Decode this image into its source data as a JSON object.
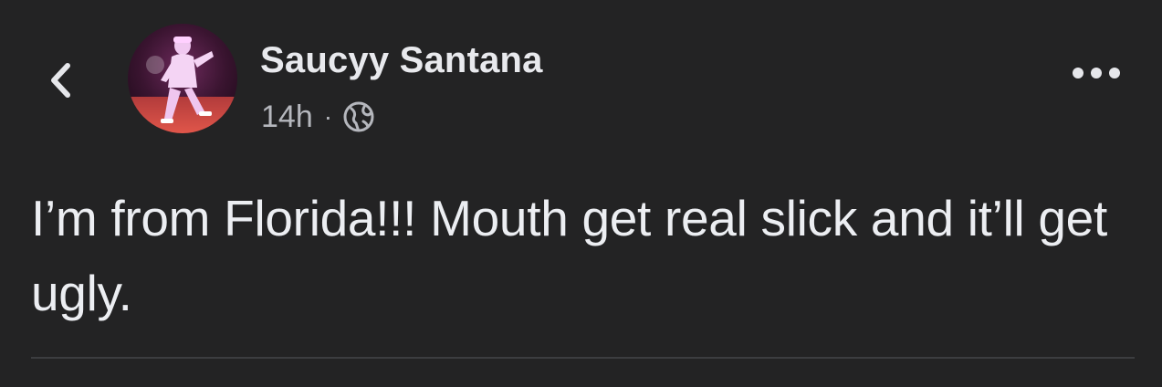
{
  "post": {
    "author": "Saucyy Santana",
    "timestamp": "14h",
    "separator": "·",
    "audience_icon": "globe-icon",
    "text": "I’m from Florida!!! Mouth get real slick and it’ll get ugly."
  },
  "icons": {
    "back": "chevron-left-icon",
    "more": "more-horizontal-icon",
    "globe": "globe-icon"
  },
  "colors": {
    "background": "#232324",
    "primary_text": "#e6e7eb",
    "secondary_text": "#b5b7bd",
    "divider": "#3c3d40"
  }
}
